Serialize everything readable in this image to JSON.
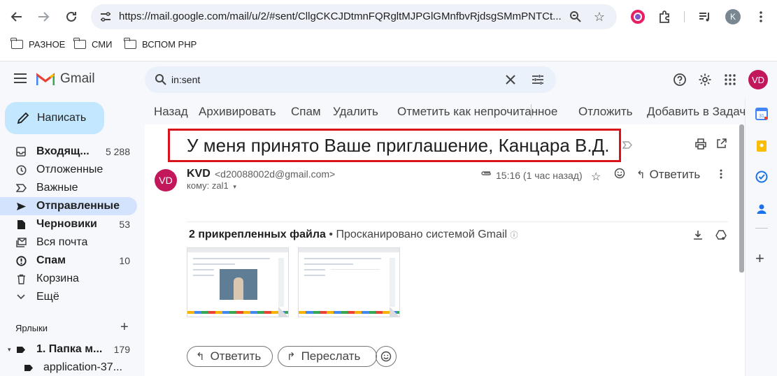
{
  "browser": {
    "url": "https://mail.google.com/mail/u/2/#sent/CllgCKCJDtmnFQRgltMJPGlGMnfbvRjdsgSMmPNTCt...",
    "profile_initial": "K",
    "bookmarks": [
      {
        "label": "РАЗНОЕ"
      },
      {
        "label": "СМИ"
      },
      {
        "label": "ВСПОМ PHP"
      }
    ]
  },
  "gmail": {
    "logo_text": "Gmail",
    "search_value": "in:sent",
    "account_initials": "VD",
    "compose_label": "Написать",
    "nav": [
      {
        "label": "Входящ...",
        "count": "5 288",
        "bold": true
      },
      {
        "label": "Отложенные",
        "count": ""
      },
      {
        "label": "Важные",
        "count": ""
      },
      {
        "label": "Отправленные",
        "count": "",
        "active": true
      },
      {
        "label": "Черновики",
        "count": "53",
        "bold": true
      },
      {
        "label": "Вся почта",
        "count": ""
      },
      {
        "label": "Спам",
        "count": "10",
        "bold": true
      },
      {
        "label": "Корзина",
        "count": ""
      },
      {
        "label": "Ещё",
        "count": ""
      }
    ],
    "labels_heading": "Ярлыки",
    "labels": [
      {
        "label": "1. Папка м...",
        "count": "179"
      },
      {
        "label": "application-37...",
        "count": ""
      }
    ]
  },
  "toolbar": {
    "back": "Назад",
    "archive": "Архивировать",
    "spam": "Спам",
    "delete": "Удалить",
    "mark_unread": "Отметить как непрочитанное",
    "snooze": "Отложить",
    "add_tasks": "Добавить в Задач"
  },
  "message": {
    "subject": "У меня принято Ваше приглашение, Канцара В.Д.",
    "sender_initials": "VD",
    "sender_name": "KVD",
    "sender_email": "<d20088002d@gmail.com>",
    "to_line": "кому: zal1",
    "time": "15:16 (1 час назад)",
    "reply_label": "Ответить",
    "attachments_title": "2 прикрепленных файла",
    "attachments_scan": "• Просканировано системой Gmail",
    "reply_button": "Ответить",
    "forward_button": "Переслать"
  }
}
